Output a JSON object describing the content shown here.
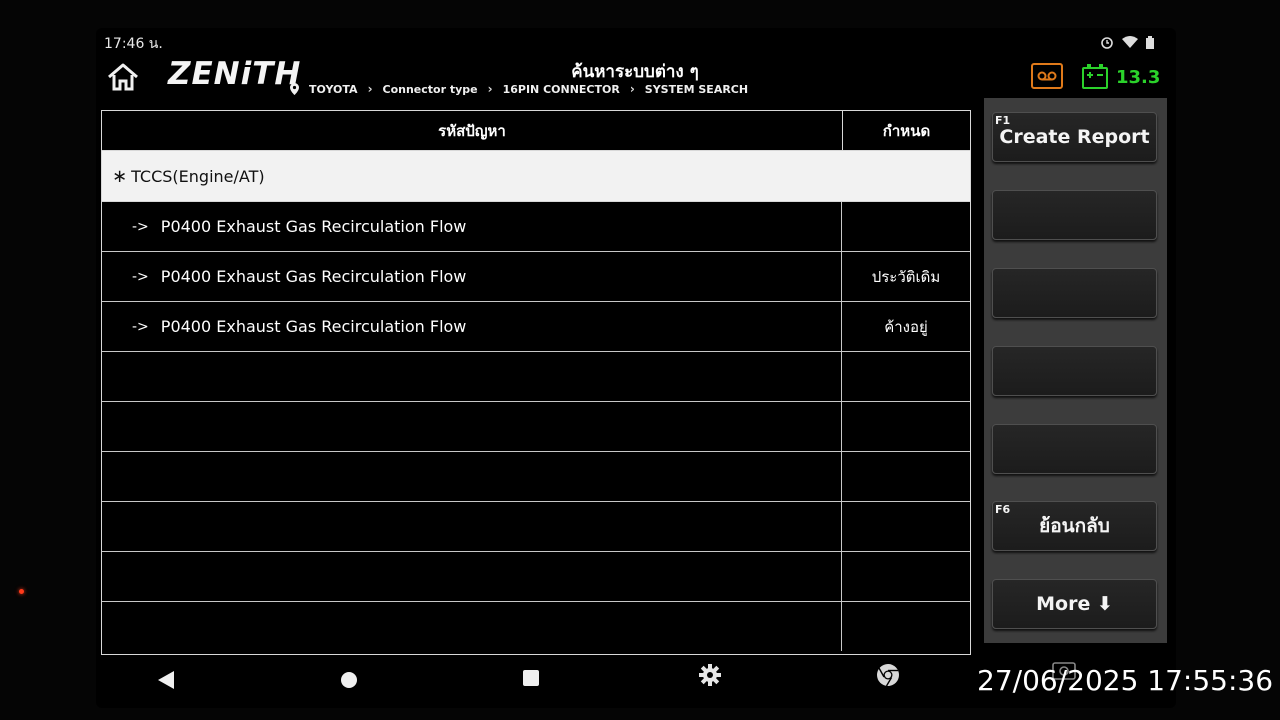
{
  "status_bar": {
    "time": "17:46 น.",
    "icons": [
      "alarm-icon",
      "wifi-icon",
      "battery-status-icon"
    ]
  },
  "header": {
    "logo": "ZENiTH",
    "title": "ค้นหาระบบต่าง ๆ",
    "breadcrumb": [
      "TOYOTA",
      "Connector type",
      "16PIN CONNECTOR",
      "SYSTEM SEARCH"
    ],
    "voltage": "13.3",
    "colors": {
      "record_icon": "#e07a1a",
      "battery_icon": "#2bd22b",
      "voltage": "#2bd22b"
    }
  },
  "table": {
    "columns": [
      "รหัสปัญหา",
      "กำหนด"
    ],
    "group": "TCCS(Engine/AT)",
    "rows": [
      {
        "code": "P0400 Exhaust Gas Recirculation Flow",
        "status": ""
      },
      {
        "code": "P0400 Exhaust Gas Recirculation Flow",
        "status": "ประวัติเดิม"
      },
      {
        "code": "P0400 Exhaust Gas Recirculation Flow",
        "status": "ค้างอยู่"
      },
      {
        "code": "",
        "status": ""
      },
      {
        "code": "",
        "status": ""
      },
      {
        "code": "",
        "status": ""
      },
      {
        "code": "",
        "status": ""
      },
      {
        "code": "",
        "status": ""
      },
      {
        "code": "",
        "status": ""
      }
    ]
  },
  "side_buttons": [
    {
      "key": "F1",
      "label": "Create Report"
    },
    {
      "key": "",
      "label": ""
    },
    {
      "key": "",
      "label": ""
    },
    {
      "key": "",
      "label": ""
    },
    {
      "key": "",
      "label": ""
    },
    {
      "key": "F6",
      "label": "ย้อนกลับ"
    },
    {
      "key": "",
      "label": "More ⬇"
    }
  ],
  "photo_timestamp": "27/06/2025 17:55:36"
}
